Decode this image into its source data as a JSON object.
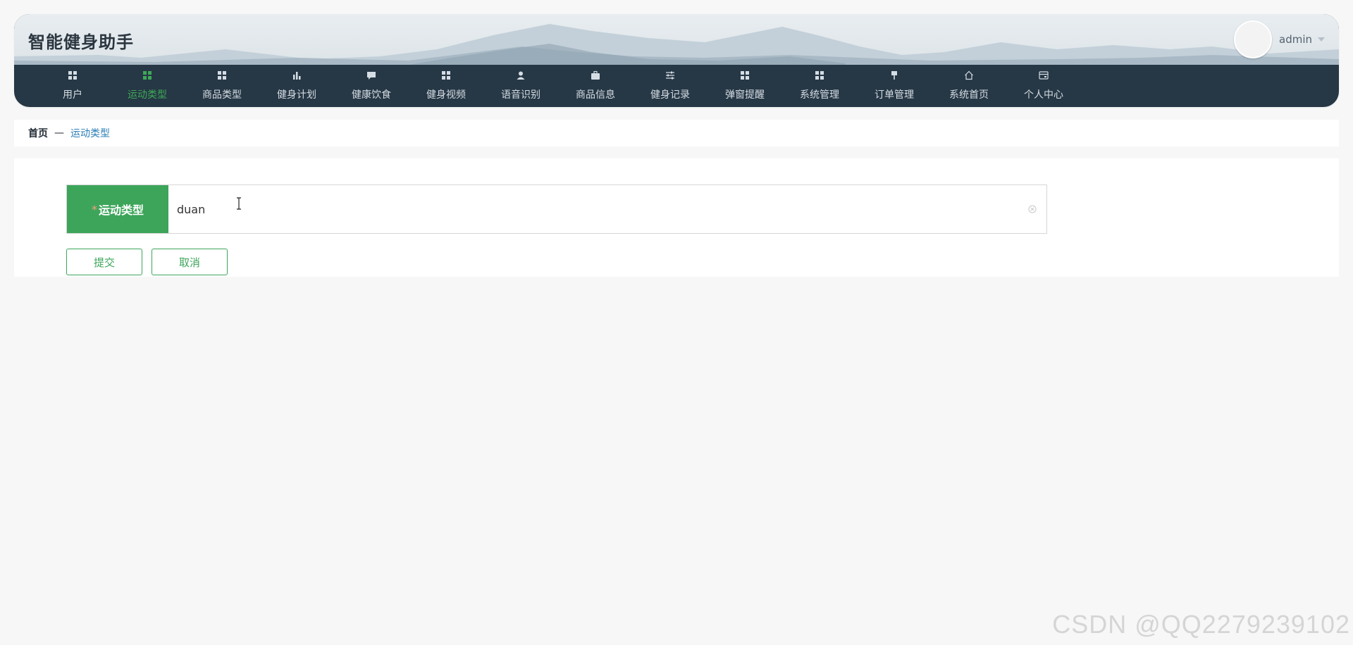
{
  "app": {
    "title": "智能健身助手",
    "user": {
      "name": "admin"
    }
  },
  "nav": {
    "items": [
      {
        "label": "用户",
        "icon": "grid-icon",
        "active": false
      },
      {
        "label": "运动类型",
        "icon": "grid-icon",
        "active": true
      },
      {
        "label": "商品类型",
        "icon": "grid-icon",
        "active": false
      },
      {
        "label": "健身计划",
        "icon": "bar-chart-icon",
        "active": false
      },
      {
        "label": "健康饮食",
        "icon": "comment-icon",
        "active": false
      },
      {
        "label": "健身视频",
        "icon": "grid-icon",
        "active": false
      },
      {
        "label": "语音识别",
        "icon": "user-icon",
        "active": false
      },
      {
        "label": "商品信息",
        "icon": "briefcase-icon",
        "active": false
      },
      {
        "label": "健身记录",
        "icon": "sliders-icon",
        "active": false
      },
      {
        "label": "弹窗提醒",
        "icon": "grid-icon",
        "active": false
      },
      {
        "label": "系统管理",
        "icon": "grid-icon",
        "active": false
      },
      {
        "label": "订单管理",
        "icon": "pin-icon",
        "active": false
      },
      {
        "label": "系统首页",
        "icon": "home-icon",
        "active": false
      },
      {
        "label": "个人中心",
        "icon": "card-icon",
        "active": false
      }
    ]
  },
  "breadcrumb": {
    "home": "首页",
    "separator": "—",
    "current": "运动类型"
  },
  "form": {
    "field_required_mark": "*",
    "field_label": "运动类型",
    "field_value": "duan",
    "submit_label": "提交",
    "cancel_label": "取消"
  },
  "watermark": "CSDN @QQ2279239102",
  "colors": {
    "accent": "#3ca55a",
    "navbar_bg": "#263745",
    "link_blue": "#2a7db5"
  }
}
